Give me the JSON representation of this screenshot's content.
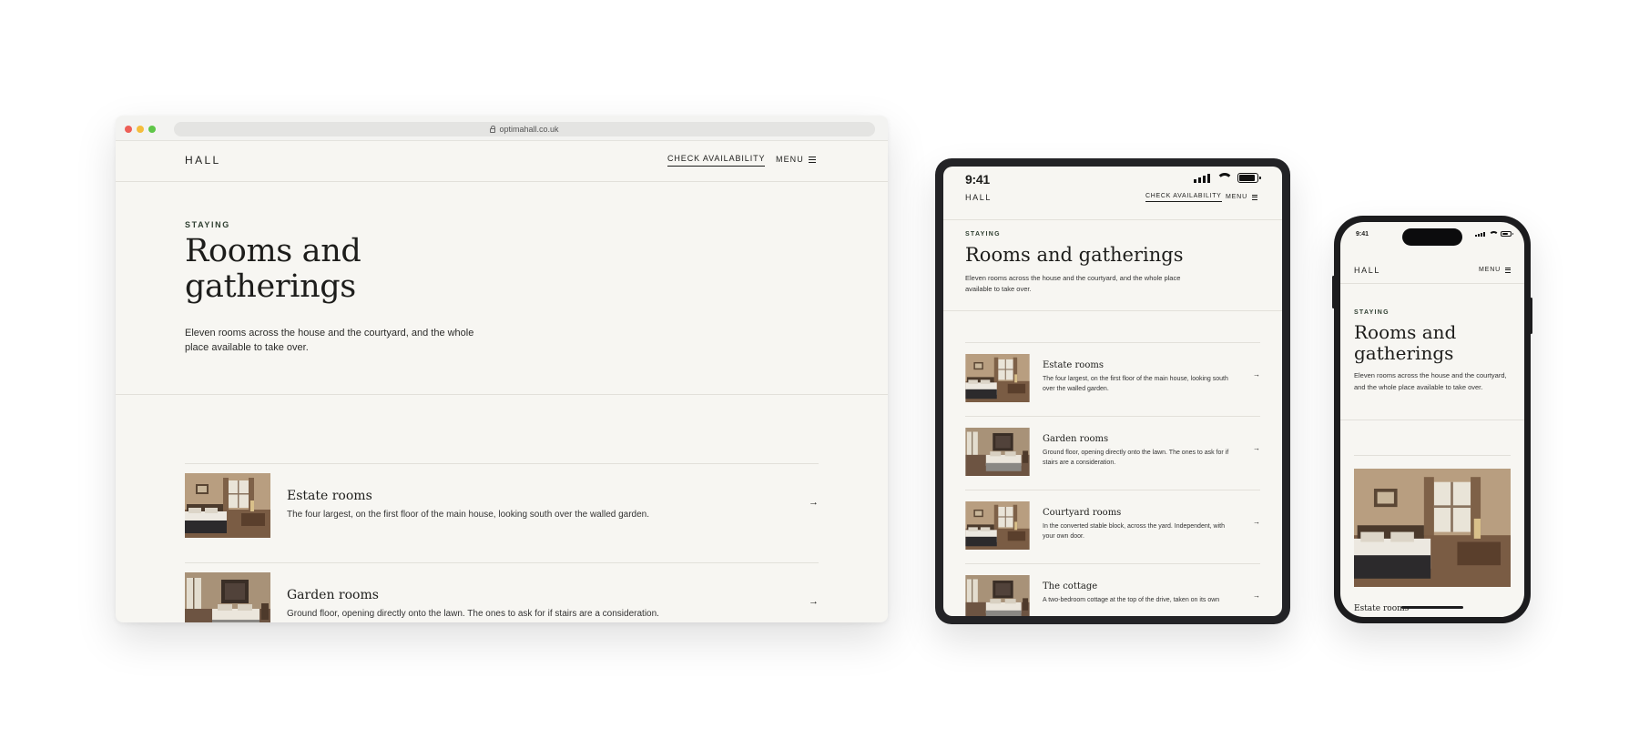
{
  "brand": {
    "logo": "HALL"
  },
  "nav": {
    "availability": "CHECK AVAILABILITY",
    "menu": "MENU"
  },
  "browser": {
    "url": "optimahall.co.uk"
  },
  "device": {
    "time": "9:41"
  },
  "hero": {
    "eyebrow": "STAYING",
    "title": "Rooms and gatherings",
    "description": "Eleven rooms across the house and the courtyard, and the whole place available to take over."
  },
  "rooms": [
    {
      "name": "Estate rooms",
      "description": "The four largest, on the first floor of the main house, looking south over the walled garden."
    },
    {
      "name": "Garden rooms",
      "description": "Ground floor, opening directly onto the lawn. The ones to ask for if stairs are a consideration."
    },
    {
      "name": "Courtyard rooms",
      "description": "In the converted stable block, across the yard. Independent, with your own door."
    },
    {
      "name": "The cottage",
      "description": "A two-bedroom cottage at the top of the drive, taken on its own"
    }
  ],
  "icons": {
    "menu": "hamburger-icon",
    "arrow": "arrow-right-icon",
    "lock": "lock-icon"
  },
  "colors": {
    "background": "#f7f6f2",
    "eyebrow": "#2f3f31",
    "text": "#1d1d1b",
    "device_frame": "#232326"
  }
}
